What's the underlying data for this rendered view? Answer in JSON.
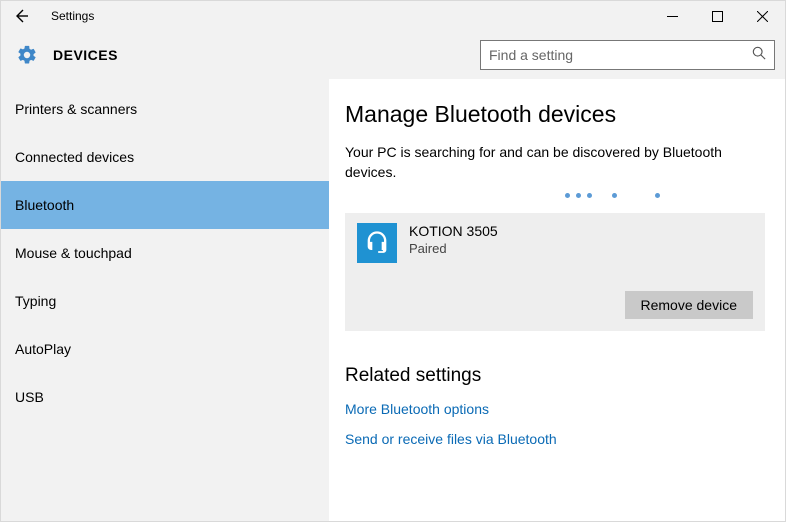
{
  "titlebar": {
    "title": "Settings"
  },
  "header": {
    "title": "DEVICES",
    "search_placeholder": "Find a setting"
  },
  "sidebar": {
    "items": [
      {
        "label": "Printers & scanners"
      },
      {
        "label": "Connected devices"
      },
      {
        "label": "Bluetooth"
      },
      {
        "label": "Mouse & touchpad"
      },
      {
        "label": "Typing"
      },
      {
        "label": "AutoPlay"
      },
      {
        "label": "USB"
      }
    ],
    "selected_index": 2
  },
  "main": {
    "heading": "Manage Bluetooth devices",
    "description": "Your PC is searching for and can be discovered by Bluetooth devices.",
    "device": {
      "name": "KOTION 3505",
      "status": "Paired",
      "remove_label": "Remove device"
    },
    "related_heading": "Related settings",
    "links": [
      "More Bluetooth options",
      "Send or receive files via Bluetooth"
    ]
  }
}
